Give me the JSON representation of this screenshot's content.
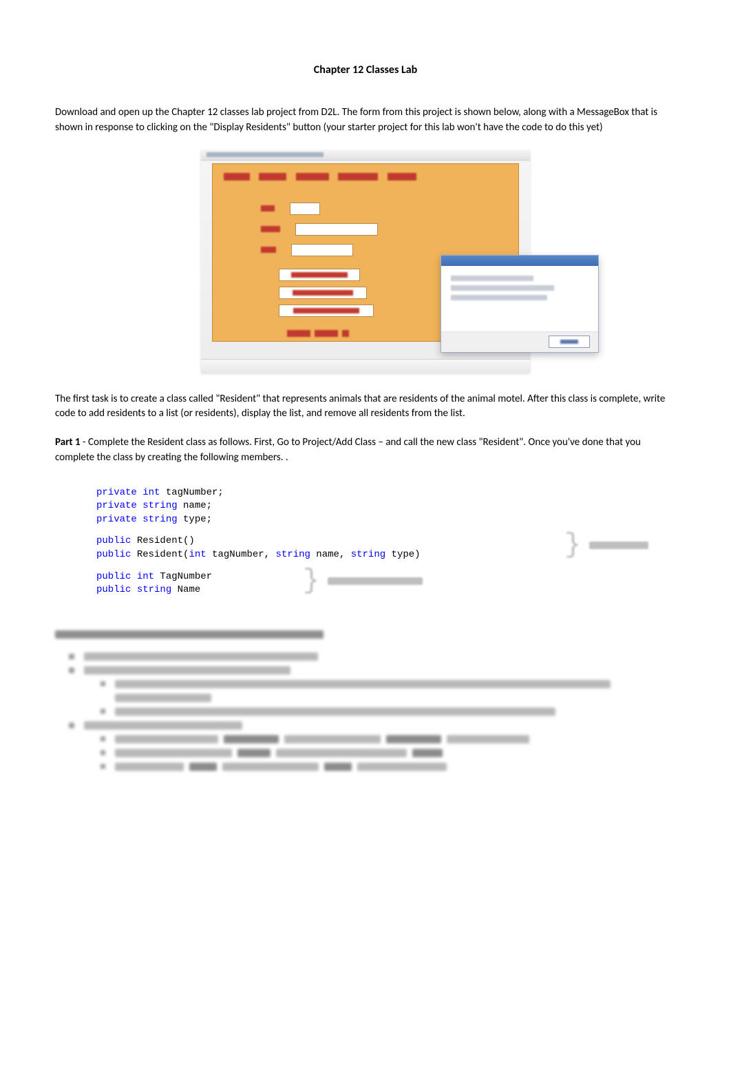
{
  "title": "Chapter 12 Classes Lab",
  "intro": "Download and open up the Chapter 12 classes lab project from D2L.   The form from this project is shown below, along with a MessageBox that is shown in response to clicking on the \"Display Residents\" button (your starter project for this lab won't have the code to do this yet)",
  "para2": "The first task is to create a class called \"Resident\" that represents animals that are residents of the animal motel.  After this class is complete, write code to add residents to a list (or residents), display the list, and remove all residents from the list.",
  "part1_label": "Part 1",
  "part1_text": " - Complete the Resident class as follows.  First, Go to Project/Add Class – and call the new class \"Resident\".    Once you've done that you complete the class by creating the following members. .",
  "code": {
    "l1a": "private",
    "l1b": " int",
    "l1c": " tagNumber;",
    "l2a": "private",
    "l2b": " string",
    "l2c": " name;",
    "l3a": "private",
    "l3b": " string",
    "l3c": " type;",
    "l4a": "public",
    "l4b": " Resident()",
    "l5a": "public",
    "l5b": " Resident(",
    "l5c": "int",
    "l5d": " tagNumber, ",
    "l5e": "string",
    "l5f": " name, ",
    "l5g": "string",
    "l5h": " type)",
    "l6a": "public",
    "l6b": " int",
    "l6c": " TagNumber",
    "l7a": "public",
    "l7b": " string",
    "l7c": " Name"
  },
  "annotations": {
    "constructors": "constructors",
    "readwrite": "read/write properties"
  }
}
